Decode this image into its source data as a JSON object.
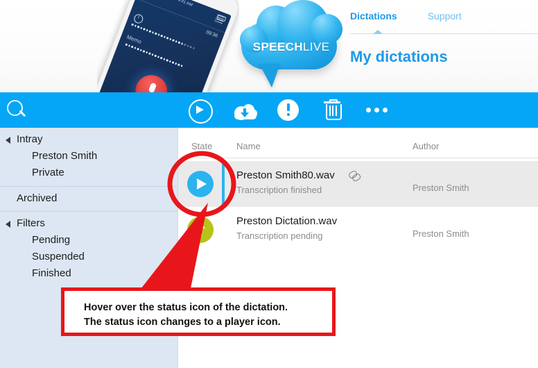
{
  "header": {
    "logo_text_bold": "SPEECH",
    "logo_text_light": "LIVE",
    "page_title": "My dictations",
    "nav_tabs": [
      {
        "label": "Dictations",
        "active": true
      },
      {
        "label": "Support",
        "active": false
      }
    ],
    "phone": {
      "status_time": "9:41 AM",
      "elapsed": "09:36",
      "label": "Memo"
    }
  },
  "toolbar": {
    "search_icon": "search-icon",
    "buttons": [
      {
        "name": "play-button",
        "icon": "play-icon"
      },
      {
        "name": "download-button",
        "icon": "cloud-download-icon"
      },
      {
        "name": "priority-button",
        "icon": "exclamation-icon"
      },
      {
        "name": "delete-button",
        "icon": "trash-icon"
      },
      {
        "name": "more-button",
        "icon": "more-ellipsis-icon"
      }
    ]
  },
  "sidebar": {
    "groups": [
      {
        "name": "intray",
        "label": "Intray",
        "expanded": true,
        "children": [
          {
            "label": "Preston Smith"
          },
          {
            "label": "Private"
          }
        ]
      },
      {
        "name": "archived",
        "label": "Archived",
        "expanded": false,
        "children": []
      },
      {
        "name": "filters",
        "label": "Filters",
        "expanded": true,
        "children": [
          {
            "label": "Pending"
          },
          {
            "label": "Suspended"
          },
          {
            "label": "Finished"
          }
        ]
      }
    ]
  },
  "list": {
    "columns": [
      {
        "key": "state",
        "label": "State"
      },
      {
        "key": "name",
        "label": "Name"
      },
      {
        "key": "author",
        "label": "Author"
      }
    ],
    "rows": [
      {
        "state_icon": "play-icon",
        "state_color": "#2bb3ef",
        "name": "Preston Smith80.wav",
        "status": "Transcription finished",
        "author": "Preston Smith",
        "has_attachment": true,
        "selected": true
      },
      {
        "state_icon": "upload-arrow-icon",
        "state_color": "#b5c417",
        "name": "Preston Dictation.wav",
        "status": "Transcription pending",
        "author": "Preston Smith",
        "has_attachment": false,
        "selected": false
      }
    ]
  },
  "annotation": {
    "callout_line1": "Hover over the status icon of the dictation.",
    "callout_line2": "The status icon changes to a  player icon.",
    "highlight_color": "#e8161a"
  },
  "colors": {
    "toolbar_blue": "#04a6f5",
    "sidebar_blue": "#dce7f3",
    "accent_blue": "#1e9ae8",
    "state_play": "#2bb3ef",
    "state_pending": "#b5c417",
    "annotation_red": "#e8161a"
  }
}
